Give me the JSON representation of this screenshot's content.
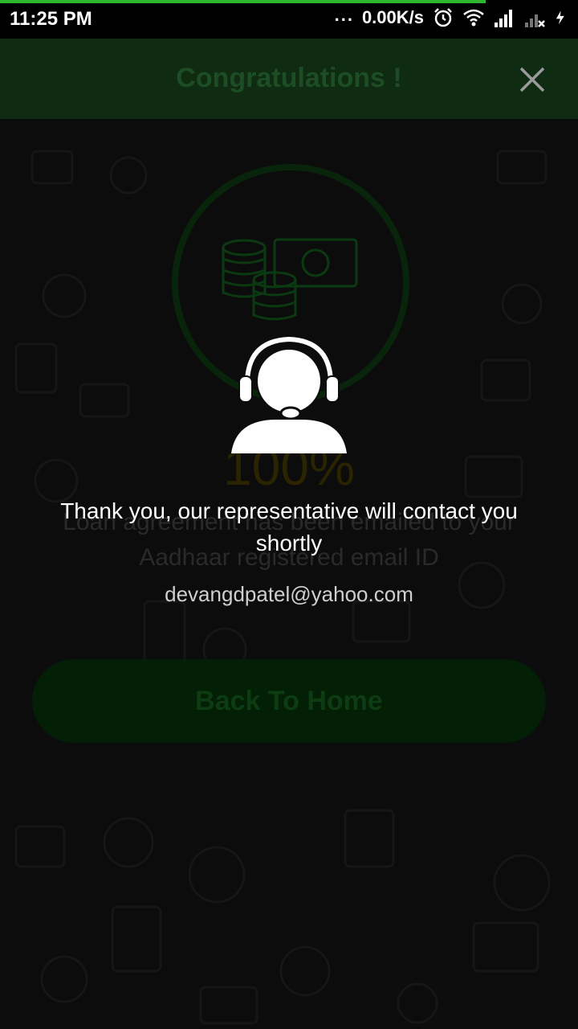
{
  "status_bar": {
    "time": "11:25 PM",
    "network_speed": "0.00K/s",
    "dots": "...",
    "load_progress": 0.84,
    "icons": [
      "alarm-icon",
      "wifi-icon",
      "signal-icon",
      "signal-no-sim-icon",
      "charging-icon"
    ]
  },
  "header": {
    "title": "Congratulations !",
    "close_icon": "close-icon"
  },
  "main": {
    "illustration": "money-coins-icon",
    "percent": "100%",
    "message": "Loan agreement has been emailed to your Aadhaar registered email ID",
    "email": "devangdpatel@yahoo.com",
    "back_button": "Back To Home"
  },
  "overlay": {
    "icon": "customer-support-icon",
    "message": "Thank you, our representative will contact you shortly"
  },
  "colors": {
    "header_bg": "#0f2b12",
    "button_bg": "#031f05",
    "progress": "#2fb82f",
    "background": "#0c0c0c"
  }
}
